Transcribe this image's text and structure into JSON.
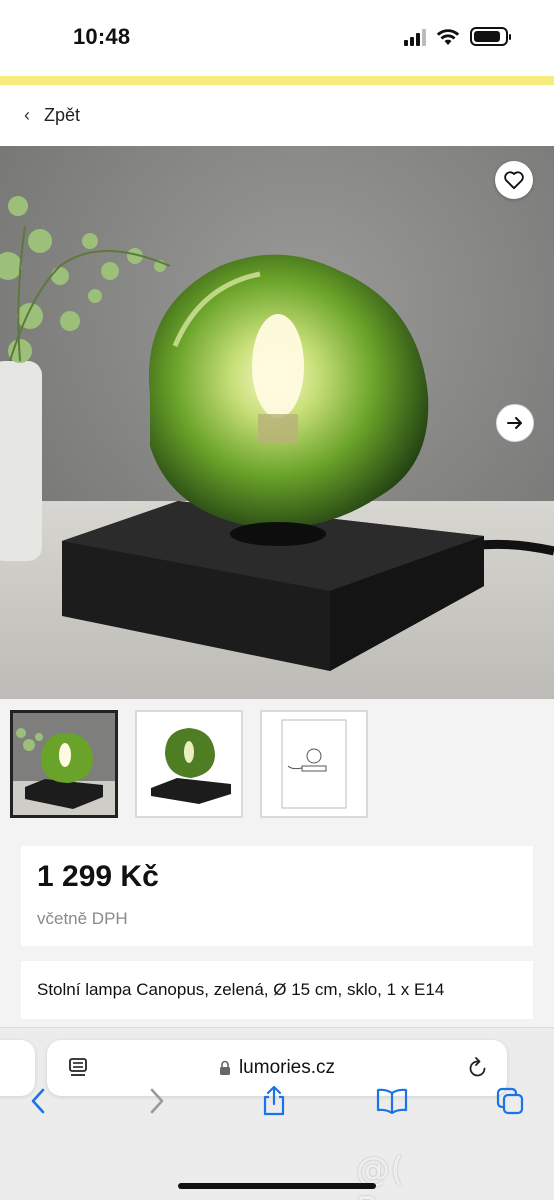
{
  "status_bar": {
    "time": "10:48",
    "signal_bars": 3,
    "battery_level": 0.85
  },
  "nav": {
    "back_label": "Zpět"
  },
  "gallery": {
    "images": [
      "lamp-lifestyle-photo",
      "lamp-product-photo",
      "lamp-dimension-drawing"
    ],
    "selected_index": 0
  },
  "product": {
    "price": "1 299 Kč",
    "vat_note": "včetně DPH",
    "title": "Stolní lampa Canopus, zelená, Ø 15 cm, sklo, 1 x E14"
  },
  "browser": {
    "url": "lumories.cz"
  },
  "icons": {
    "favorite": "heart-icon",
    "next": "arrow-right-icon",
    "reader": "reader-icon",
    "lock": "lock-icon",
    "reload": "reload-icon",
    "back": "chevron-left-icon",
    "forward": "chevron-right-icon",
    "share": "share-icon",
    "bookmarks": "book-icon",
    "tabs": "tabs-icon"
  },
  "colors": {
    "accent_strip": "#f6ec7c",
    "browser_blue": "#1a73e8",
    "glass_green": "#6aa329"
  },
  "watermark": "@( Bazos.cz"
}
